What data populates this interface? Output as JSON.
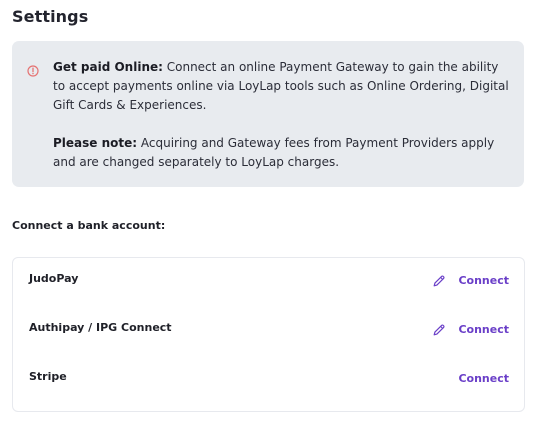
{
  "page": {
    "title": "Settings"
  },
  "notice": {
    "icon": "alert-circle-icon",
    "icon_color": "#e57373",
    "background": "#e8ebef",
    "para1_bold": "Get paid Online:",
    "para1_text": " Connect an online Payment Gateway to gain the ability to accept payments online via LoyLap tools such as Online Ordering, Digital Gift Cards & Experiences.",
    "para2_bold": "Please note:",
    "para2_text": " Acquiring and Gateway fees from Payment Providers apply and are changed separately to LoyLap charges."
  },
  "bank_section": {
    "label": "Connect a bank account:",
    "accent_color": "#6a3fc8",
    "providers": [
      {
        "name": "JudoPay",
        "action": "Connect",
        "icon": "pencil-icon"
      },
      {
        "name": "Authipay / IPG Connect",
        "action": "Connect",
        "icon": "pencil-icon"
      },
      {
        "name": "Stripe",
        "action": "Connect",
        "icon": ""
      }
    ]
  }
}
